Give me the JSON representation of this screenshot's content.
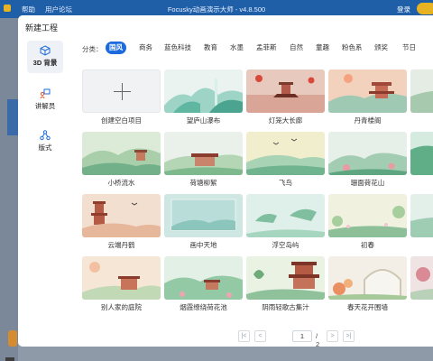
{
  "titlebar": {
    "menu_help": "帮助",
    "menu_forum": "用户论坛",
    "app_title": "Focusky动画演示大师 - v4.8.500",
    "login": "登录"
  },
  "dialog": {
    "title": "新建工程"
  },
  "sidebar": {
    "items": [
      {
        "label": "3D 背景",
        "icon": "cube-icon"
      },
      {
        "label": "讲解员",
        "icon": "presenter-icon"
      },
      {
        "label": "版式",
        "icon": "layout-icon"
      }
    ]
  },
  "filter": {
    "label": "分类：",
    "categories": [
      "国风",
      "商务",
      "蓝色科技",
      "教育",
      "水墨",
      "孟菲斯",
      "自然",
      "童趣",
      "粉色系",
      "颁奖",
      "节日"
    ]
  },
  "templates": {
    "create_blank": "创建空白项目",
    "items": [
      "望庐山瀑布",
      "灯笼大长廊",
      "丹青楼阁",
      "小桥流水",
      "荷塘柳絮",
      "飞鸟",
      "珊面荷花山",
      "云端丹鹤",
      "画中天地",
      "浮空岛屿",
      "初春",
      "别人家的庭院",
      "烟霞缭绕荷花池",
      "阴雨轻歌古集汁",
      "春天花开围墙"
    ]
  },
  "pager": {
    "current": "1",
    "total": "/ 2"
  },
  "colors": {
    "accent": "#1c6ae0",
    "titlebar": "#1f5fa8"
  }
}
